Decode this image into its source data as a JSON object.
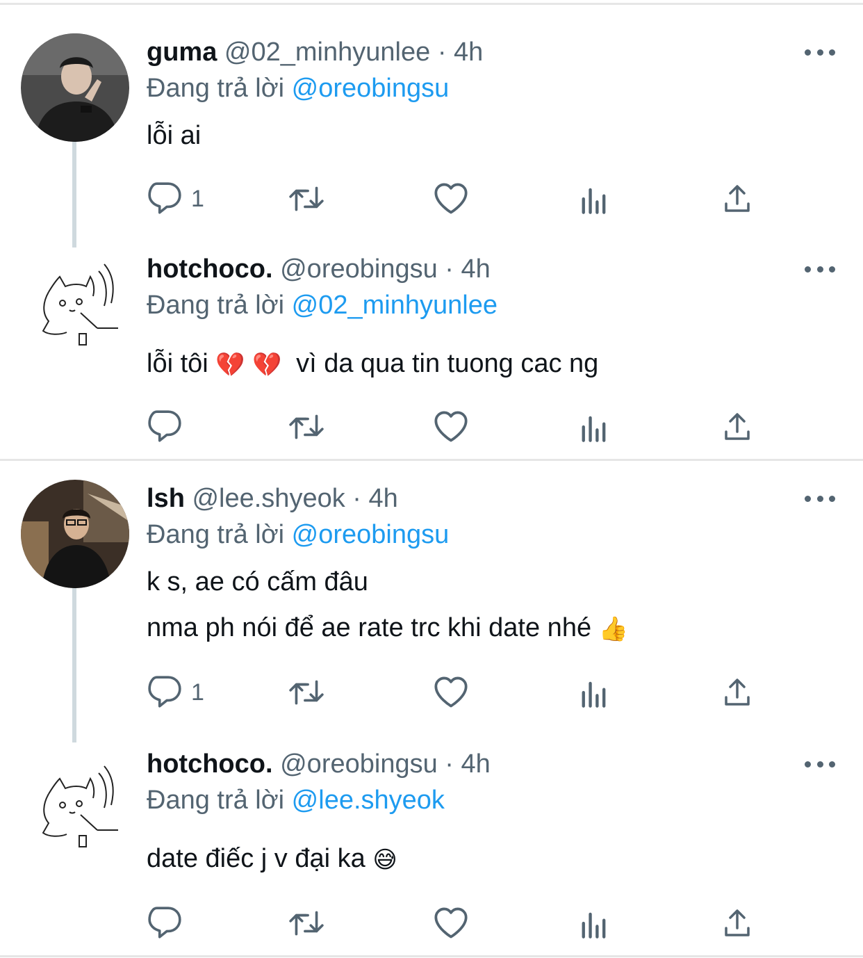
{
  "threads": [
    {
      "tweets": [
        {
          "name": "guma",
          "handle": "@02_minhyunlee",
          "time": "4h",
          "replying_prefix": "Đang trả lời",
          "replying_to": "@oreobingsu",
          "lines": [
            "lỗi ai"
          ],
          "reply_count": "1",
          "avatar": "photo-avatar"
        },
        {
          "name": "hotchoco.",
          "handle": "@oreobingsu",
          "time": "4h",
          "replying_prefix": "Đang trả lời",
          "replying_to": "@02_minhyunlee",
          "lines": [
            "lỗi tôi",
            "vì da qua tin tuong cac ng"
          ],
          "reply_count": "",
          "avatar": "cat-sketch-avatar"
        }
      ]
    },
    {
      "tweets": [
        {
          "name": "lsh",
          "handle": "@lee.shyeok",
          "time": "4h",
          "replying_prefix": "Đang trả lời",
          "replying_to": "@oreobingsu",
          "lines": [
            "k s, ae có cấm đâu",
            "nma ph nói để ae rate trc khi date nhé"
          ],
          "reply_count": "1",
          "avatar": "photo-avatar"
        },
        {
          "name": "hotchoco.",
          "handle": "@oreobingsu",
          "time": "4h",
          "replying_prefix": "Đang trả lời",
          "replying_to": "@lee.shyeok",
          "lines": [
            "date điếc j v đại ka"
          ],
          "reply_count": "",
          "avatar": "cat-sketch-avatar"
        }
      ]
    }
  ],
  "separator": "·",
  "emojis": {
    "broken_heart": "💔",
    "thumbs_up": "👍",
    "sweat_smile": "😅"
  },
  "colors": {
    "text": "#0f1419",
    "secondary": "#536471",
    "accent": "#1d9bf0",
    "divider": "#e6e6e6",
    "thread_line": "#cfd9de"
  }
}
